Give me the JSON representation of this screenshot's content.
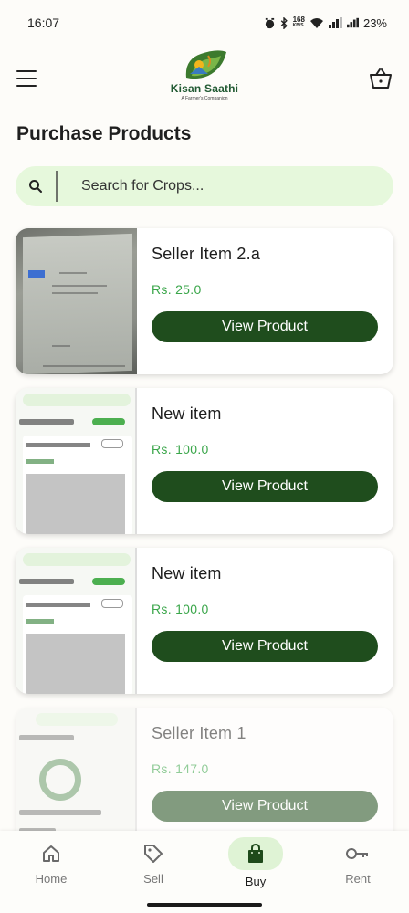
{
  "status_bar": {
    "time": "16:07",
    "net_speed": "168",
    "net_unit": "KB/S",
    "battery": "23%"
  },
  "app": {
    "name": "Kisan Saathi",
    "tagline": "A Farmer's Companion"
  },
  "page": {
    "title": "Purchase Products"
  },
  "search": {
    "placeholder": "Search for Crops..."
  },
  "products": [
    {
      "title": "Seller Item 2.a",
      "price": "Rs. 25.0",
      "button": "View Product"
    },
    {
      "title": "New item",
      "price": "Rs. 100.0",
      "button": "View Product"
    },
    {
      "title": "New item",
      "price": "Rs. 100.0",
      "button": "View Product"
    },
    {
      "title": "Seller Item 1",
      "price": "Rs. 147.0",
      "button": "View Product"
    }
  ],
  "nav": [
    {
      "label": "Home",
      "icon": "home-icon"
    },
    {
      "label": "Sell",
      "icon": "tag-icon"
    },
    {
      "label": "Buy",
      "icon": "shopping-bag-icon",
      "active": true
    },
    {
      "label": "Rent",
      "icon": "key-icon"
    }
  ],
  "colors": {
    "primary": "#1f4d1d",
    "price": "#3aa64a",
    "search_bg": "#e6f8dc",
    "active_nav": "#dff3d5"
  }
}
